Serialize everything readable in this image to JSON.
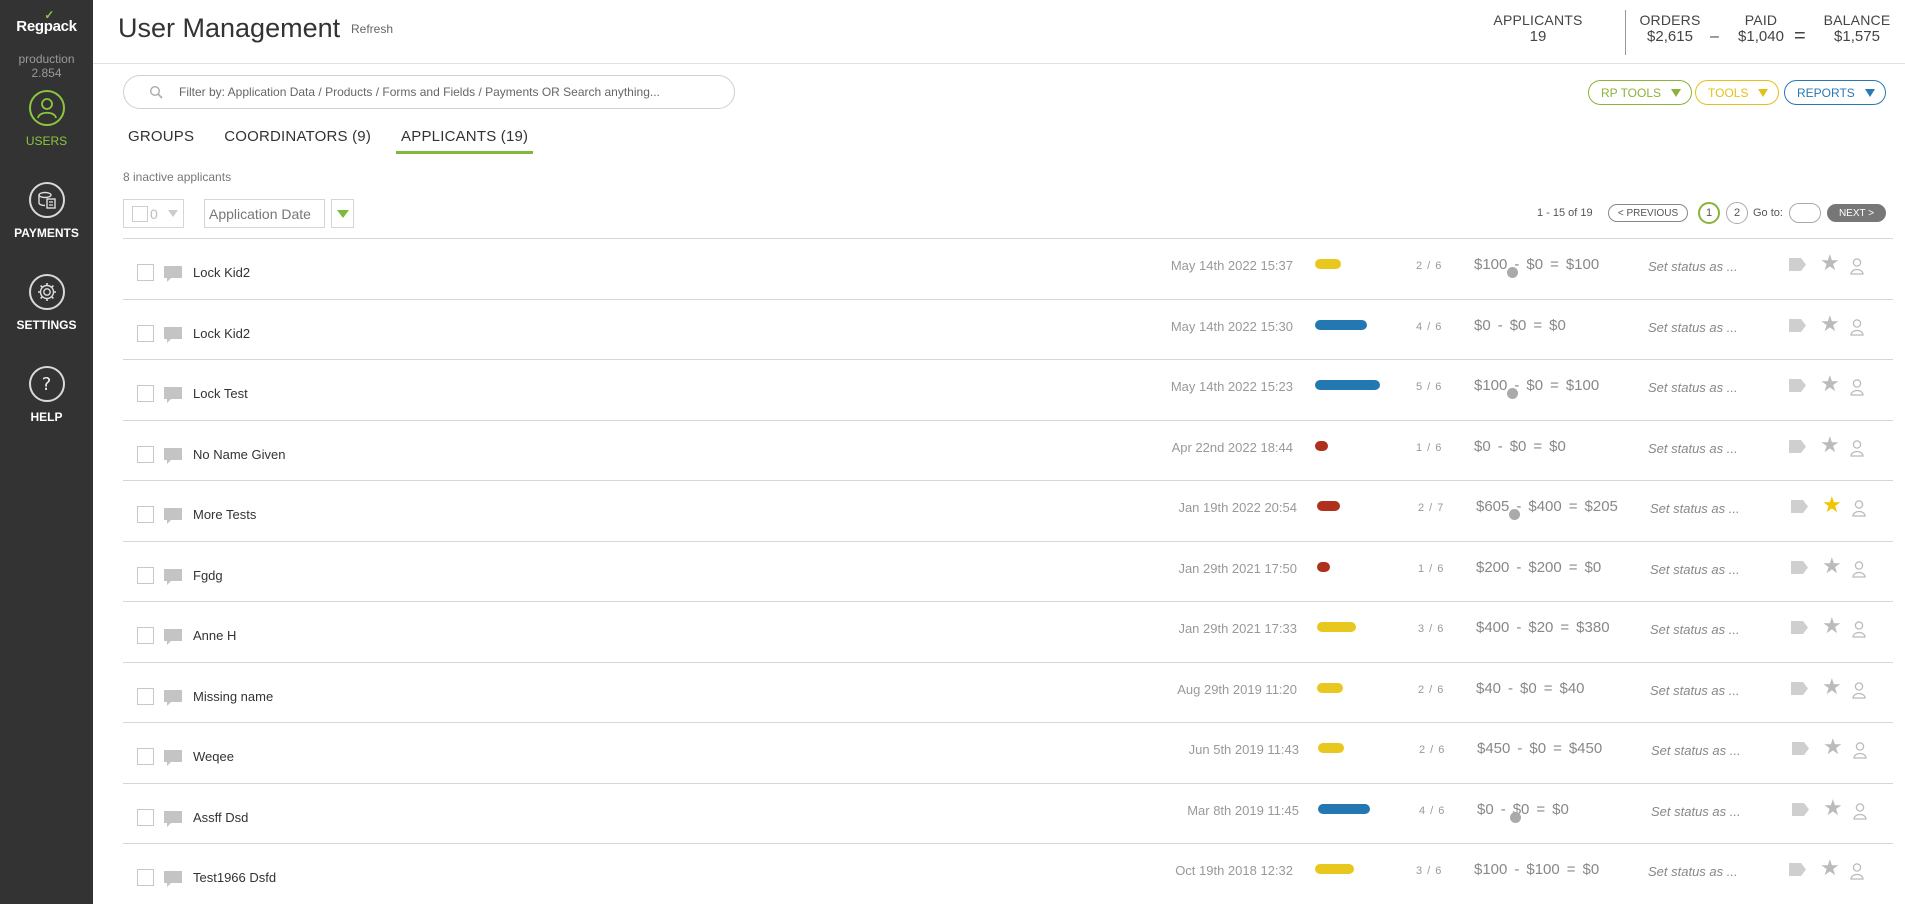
{
  "sidebar": {
    "logo": "Regpack",
    "env": "production",
    "version": "2.854",
    "items": [
      {
        "label": "USERS",
        "icon": "user-icon"
      },
      {
        "label": "PAYMENTS",
        "icon": "payments-icon"
      },
      {
        "label": "SETTINGS",
        "icon": "gear-icon"
      },
      {
        "label": "HELP",
        "icon": "help-icon"
      }
    ]
  },
  "header": {
    "title": "User Management",
    "refresh": "Refresh",
    "stats": {
      "applicants_label": "APPLICANTS",
      "applicants_value": "19",
      "orders_label": "ORDERS",
      "orders_value": "$2,615",
      "paid_label": "PAID",
      "paid_value": "$1,040",
      "balance_label": "BALANCE",
      "balance_value": "$1,575",
      "minus": "–",
      "equals": "="
    }
  },
  "search": {
    "placeholder": "Filter by: Application Data / Products / Forms and Fields / Payments OR Search anything..."
  },
  "toolbar": {
    "rp_tools": "RP TOOLS",
    "tools": "TOOLS",
    "reports": "REPORTS"
  },
  "colors": {
    "rp_tools": "#8bb33b",
    "tools": "#e3c11c",
    "reports": "#2979b5",
    "accent": "#8cc63f"
  },
  "tabs": [
    {
      "label": "GROUPS"
    },
    {
      "label": "COORDINATORS (9)"
    },
    {
      "label": "APPLICANTS (19)",
      "active": true
    }
  ],
  "inactive_text": "8 inactive applicants",
  "filter": {
    "selected_count": "0",
    "sort_by": "Application Date"
  },
  "pager": {
    "info": "1 - 15 of 19",
    "prev": "< PREVIOUS",
    "page1": "1",
    "page2": "2",
    "goto": "Go to:",
    "next": "NEXT >"
  },
  "rows": [
    {
      "name": "Lock Kid2",
      "date": "May 14th 2022 15:37",
      "progress": 0.33,
      "bar_color": "#e8c81e",
      "step": "2 / 6",
      "amount": "$100",
      "paid": "$0",
      "balance": "$100",
      "info": true,
      "status": "Set status as ...",
      "starred": false
    },
    {
      "name": "Lock Kid2",
      "date": "May 14th 2022 15:30",
      "progress": 0.67,
      "bar_color": "#2478b2",
      "step": "4 / 6",
      "amount": "$0",
      "paid": "$0",
      "balance": "$0",
      "info": false,
      "status": "Set status as ...",
      "starred": false
    },
    {
      "name": "Lock Test",
      "date": "May 14th 2022 15:23",
      "progress": 0.83,
      "bar_color": "#2478b2",
      "step": "5 / 6",
      "amount": "$100",
      "paid": "$0",
      "balance": "$100",
      "info": true,
      "status": "Set status as ...",
      "starred": false
    },
    {
      "name": "No Name Given",
      "date": "Apr 22nd 2022 18:44",
      "progress": 0.17,
      "bar_color": "#b0301e",
      "step": "1 / 6",
      "amount": "$0",
      "paid": "$0",
      "balance": "$0",
      "info": false,
      "status": "Set status as ...",
      "starred": false
    },
    {
      "name": "More Tests",
      "date": "Jan 19th 2022 20:54",
      "progress": 0.29,
      "bar_color": "#b0301e",
      "step": "2 / 7",
      "amount": "$605",
      "paid": "$400",
      "balance": "$205",
      "info": true,
      "status": "Set status as ...",
      "starred": true
    },
    {
      "name": "Fgdg",
      "date": "Jan 29th 2021 17:50",
      "progress": 0.17,
      "bar_color": "#b0301e",
      "step": "1 / 6",
      "amount": "$200",
      "paid": "$200",
      "balance": "$0",
      "info": false,
      "status": "Set status as ...",
      "starred": false
    },
    {
      "name": "Anne H",
      "date": "Jan 29th 2021 17:33",
      "progress": 0.5,
      "bar_color": "#e8c81e",
      "step": "3 / 6",
      "amount": "$400",
      "paid": "$20",
      "balance": "$380",
      "info": false,
      "status": "Set status as ...",
      "starred": false
    },
    {
      "name": "Missing name",
      "date": "Aug 29th 2019 11:20",
      "progress": 0.33,
      "bar_color": "#e8c81e",
      "step": "2 / 6",
      "amount": "$40",
      "paid": "$0",
      "balance": "$40",
      "info": false,
      "status": "Set status as ...",
      "starred": false
    },
    {
      "name": "Weqee",
      "date": "Jun 5th 2019 11:43",
      "progress": 0.33,
      "bar_color": "#e8c81e",
      "step": "2 / 6",
      "amount": "$450",
      "paid": "$0",
      "balance": "$450",
      "info": false,
      "status": "Set status as ...",
      "starred": false
    },
    {
      "name": "Assff Dsd",
      "date": "Mar 8th 2019 11:45",
      "progress": 0.67,
      "bar_color": "#2478b2",
      "step": "4 / 6",
      "amount": "$0",
      "paid": "$0",
      "balance": "$0",
      "info": true,
      "status": "Set status as ...",
      "starred": false
    },
    {
      "name": "Test1966 Dsfd",
      "date": "Oct 19th 2018 12:32",
      "progress": 0.5,
      "bar_color": "#e8c81e",
      "step": "3 / 6",
      "amount": "$100",
      "paid": "$100",
      "balance": "$0",
      "info": false,
      "status": "Set status as ...",
      "starred": false
    }
  ],
  "row_symbols": {
    "minus": "-",
    "equals": "=",
    "star": "★"
  }
}
